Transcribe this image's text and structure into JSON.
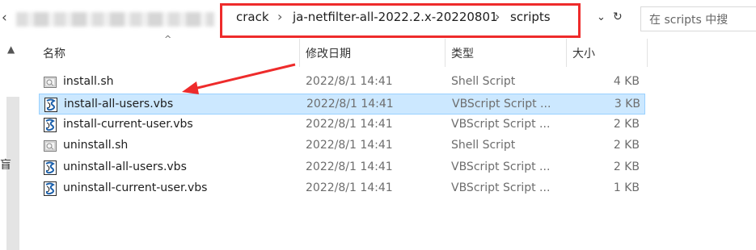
{
  "address": {
    "crumbs": [
      "crack",
      "ja-netfilter-all-2022.2.x-20220801",
      "scripts"
    ],
    "search_placeholder": "在 scripts 中搜",
    "highlight_color": "#ee2b2b"
  },
  "columns": {
    "name": "名称",
    "modified": "修改日期",
    "type": "类型",
    "size": "大小"
  },
  "files": [
    {
      "name": "install.sh",
      "modified": "2022/8/1 14:41",
      "type": "Shell Script",
      "size": "4 KB",
      "icon": "sh-file-icon"
    },
    {
      "name": "install-all-users.vbs",
      "modified": "2022/8/1 14:41",
      "type": "VBScript Script ...",
      "size": "3 KB",
      "icon": "vbs-file-icon",
      "selected": true
    },
    {
      "name": "install-current-user.vbs",
      "modified": "2022/8/1 14:41",
      "type": "VBScript Script ...",
      "size": "2 KB",
      "icon": "vbs-file-icon"
    },
    {
      "name": "uninstall.sh",
      "modified": "2022/8/1 14:41",
      "type": "Shell Script",
      "size": "2 KB",
      "icon": "sh-file-icon"
    },
    {
      "name": "uninstall-all-users.vbs",
      "modified": "2022/8/1 14:41",
      "type": "VBScript Script ...",
      "size": "2 KB",
      "icon": "vbs-file-icon"
    },
    {
      "name": "uninstall-current-user.vbs",
      "modified": "2022/8/1 14:41",
      "type": "VBScript Script ...",
      "size": "1 KB",
      "icon": "vbs-file-icon"
    }
  ],
  "sidebar_partial_text": "盲",
  "colors": {
    "selection": "#cce8ff",
    "selection_border": "#99d1ff",
    "annotation": "#ee2b2b"
  }
}
